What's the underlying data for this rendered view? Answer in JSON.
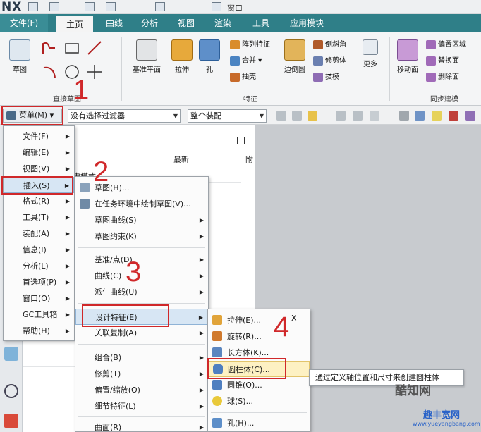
{
  "app": {
    "logo": "NX",
    "window_menu_label": "窗口"
  },
  "ribbon_tabs": [
    "文件(F)",
    "主页",
    "曲线",
    "分析",
    "视图",
    "渲染",
    "工具",
    "应用模块"
  ],
  "ribbon": {
    "sketch_label": "草图",
    "direct_sketch_label": "直接草图",
    "datum_plane": "基准平面",
    "extrude": "拉伸",
    "hole": "孔",
    "pattern_feature": "阵列特征",
    "unite": "合并",
    "shell": "抽壳",
    "edge_blend": "边倒圆",
    "chamfer": "倒斜角",
    "trim_body": "修剪体",
    "draft": "拔模",
    "more": "更多",
    "feature_label": "特征",
    "move_face": "移动面",
    "offset_region": "偏置区域",
    "replace_face": "替换面",
    "delete_face": "删除面",
    "sync_modeling_label": "同步建模"
  },
  "command_bar": {
    "menu_button": "菜单(M)",
    "filter_combo": "没有选择过滤器",
    "assembly_combo": "整个装配"
  },
  "nav": {
    "col_latest": "最新",
    "col_extra": "附",
    "history_mode": "历史模式"
  },
  "main_menu": [
    "文件(F)",
    "编辑(E)",
    "视图(V)",
    "插入(S)",
    "格式(R)",
    "工具(T)",
    "装配(A)",
    "信息(I)",
    "分析(L)",
    "首选项(P)",
    "窗口(O)",
    "GC工具箱",
    "帮助(H)"
  ],
  "insert_menu": {
    "sketch": "草图(H)...",
    "sketch_in_task": "在任务环境中绘制草图(V)...",
    "sketch_curve": "草图曲线(S)",
    "sketch_constraint": "草图约束(K)",
    "datum_point": "基准/点(D)",
    "curve": "曲线(C)",
    "derived_curve": "派生曲线(U)",
    "design_feature": "设计特征(E)",
    "associative_copy": "关联复制(A)",
    "combine": "组合(B)",
    "trim": "修剪(T)",
    "offset_scale": "偏置/缩放(O)",
    "detail_feature": "细节特征(L)",
    "surface": "曲面(R)"
  },
  "design_feature_menu": {
    "extrude": "拉伸(E)...",
    "revolve": "旋转(R)...",
    "block": "长方体(K)...",
    "cylinder": "圆柱体(C)...",
    "cone": "圆锥(O)...",
    "sphere": "球(S)...",
    "hole": "孔(H)...",
    "extra_mark": "X"
  },
  "tooltip": "通过定义轴位置和尺寸来创建圆柱体",
  "steps": [
    "1",
    "2",
    "3",
    "4"
  ],
  "watermark": {
    "brand": "酷知网",
    "site_cn": "趣丰宽网",
    "site_url": "www.yueyangbang.com"
  },
  "colors": {
    "ribbon_tab_bg": "#2f7f88",
    "highlight_red": "#d0282a",
    "graphics_bg": "#c8cbcf"
  }
}
